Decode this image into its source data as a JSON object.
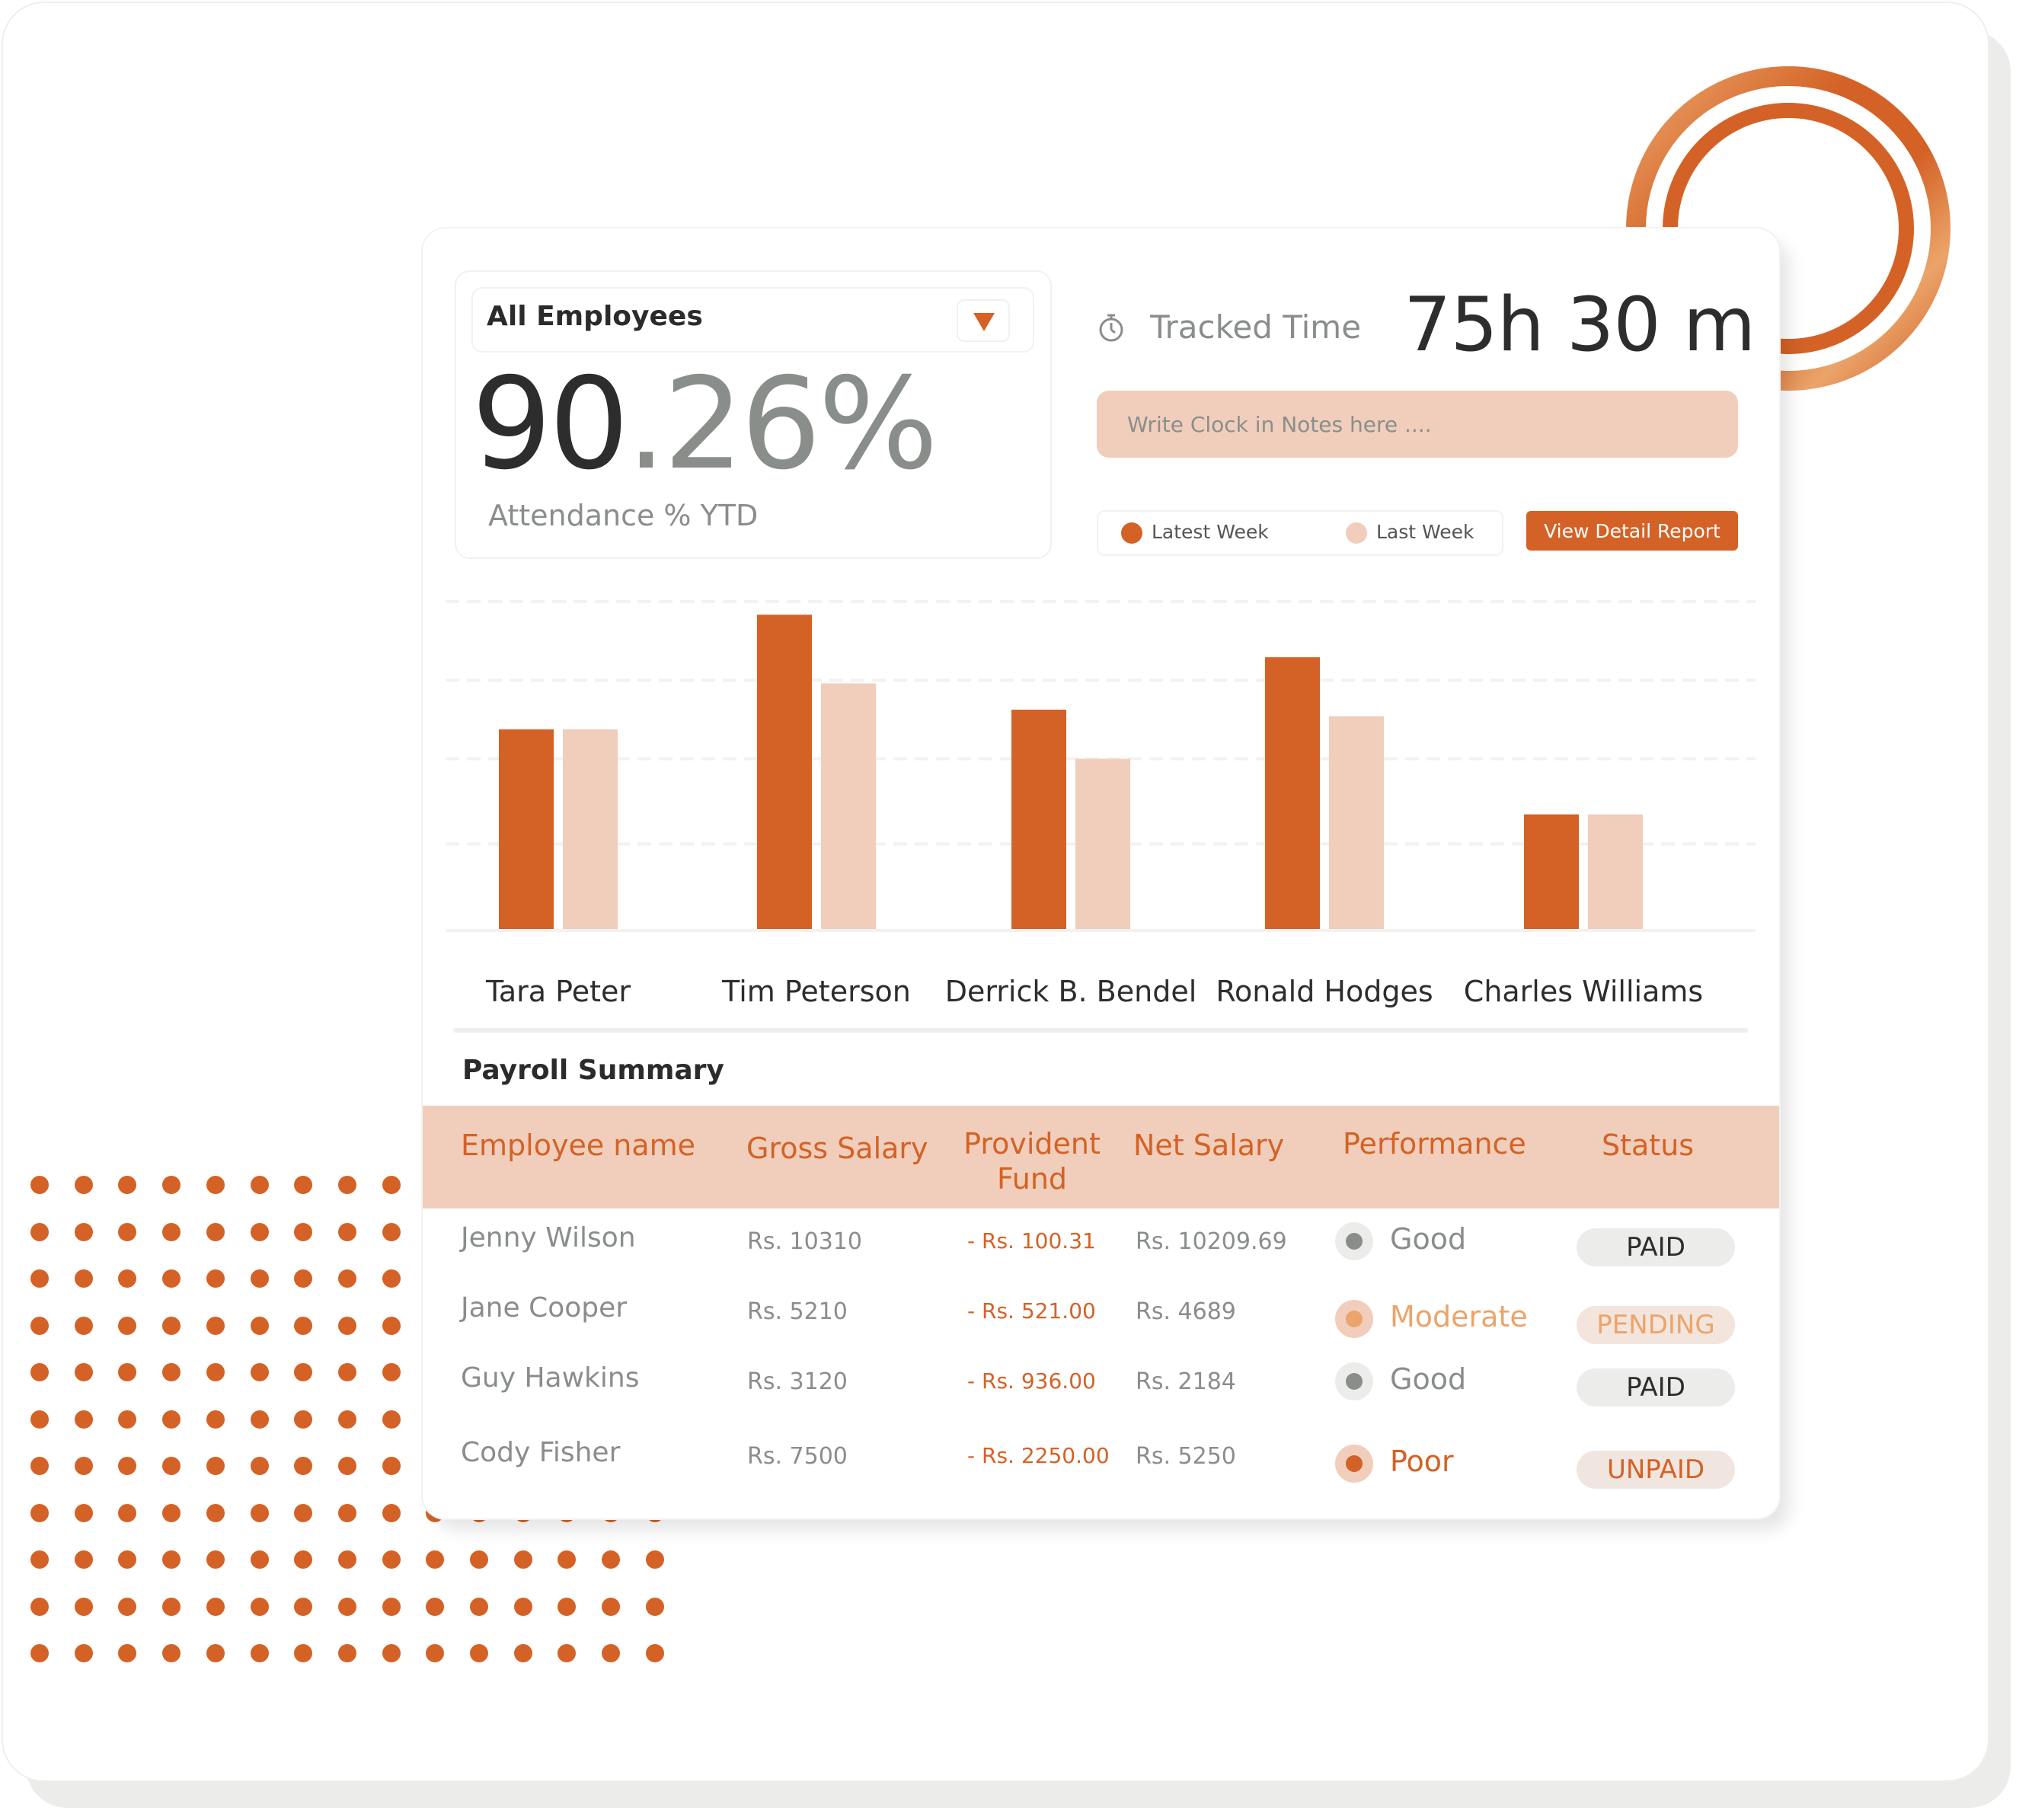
{
  "attendance": {
    "filter_label": "All Employees",
    "value_whole": "90",
    "value_decimal": ".26%",
    "label": "Attendance % YTD"
  },
  "tracked": {
    "label": "Tracked Time",
    "value": "75h 30 m",
    "icon": "stopwatch-icon"
  },
  "notes": {
    "placeholder": "Write Clock in Notes here ...."
  },
  "legend": {
    "latest": "Latest Week",
    "last": "Last Week"
  },
  "report_button": "View Detail Report",
  "colors": {
    "accent": "#d46226",
    "accent_light": "#f0cebb",
    "moderate": "#eba46a",
    "muted": "#8a8e8b",
    "text_dark": "#2d2d2d"
  },
  "chart_data": {
    "type": "bar",
    "title": "",
    "xlabel": "",
    "ylabel": "",
    "ylim": [
      0,
      100
    ],
    "grid": true,
    "legend": "top-right",
    "categories": [
      "Tara Peter",
      "Tim Peterson",
      "Derrick B. Bendel",
      "Ronald Hodges",
      "Charles Williams"
    ],
    "series": [
      {
        "name": "Latest Week",
        "color": "#d46226",
        "values": [
          61,
          96,
          67,
          83,
          35
        ]
      },
      {
        "name": "Last Week",
        "color": "#f0cebb",
        "values": [
          61,
          75,
          52,
          65,
          35
        ]
      }
    ]
  },
  "payroll": {
    "title": "Payroll Summary",
    "columns": [
      "Employee name",
      "Gross Salary",
      "Provident Fund",
      "Net Salary",
      "Performance",
      "Status"
    ],
    "rows": [
      {
        "name": "Jenny Wilson",
        "gross": "Rs. 10310",
        "pf": "- Rs. 100.31",
        "net": "Rs. 10209.69",
        "performance": "Good",
        "status": "PAID"
      },
      {
        "name": "Jane Cooper",
        "gross": "Rs. 5210",
        "pf": "- Rs. 521.00",
        "net": "Rs. 4689",
        "performance": "Moderate",
        "status": "PENDING"
      },
      {
        "name": "Guy Hawkins",
        "gross": "Rs. 3120",
        "pf": "- Rs. 936.00",
        "net": "Rs. 2184",
        "performance": "Good",
        "status": "PAID"
      },
      {
        "name": "Cody Fisher",
        "gross": "Rs. 7500",
        "pf": "- Rs. 2250.00",
        "net": "Rs. 5250",
        "performance": "Poor",
        "status": "UNPAID"
      }
    ]
  }
}
